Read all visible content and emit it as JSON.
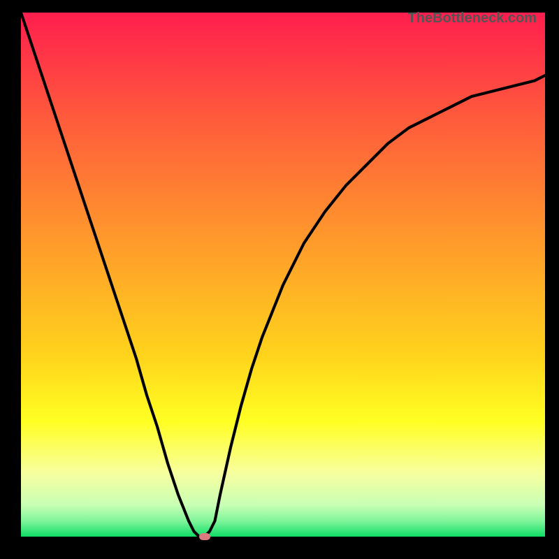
{
  "watermark": "TheBottleneck.com",
  "chart_data": {
    "type": "line",
    "title": "",
    "xlabel": "",
    "ylabel": "",
    "xlim": [
      0,
      100
    ],
    "ylim": [
      0,
      100
    ],
    "grid": false,
    "series": [
      {
        "name": "bottleneck-curve",
        "x": [
          0,
          2,
          4,
          6,
          8,
          10,
          12,
          14,
          16,
          18,
          20,
          22,
          24,
          26,
          28,
          30,
          32,
          33,
          34,
          35,
          36,
          37,
          38,
          40,
          42,
          44,
          46,
          48,
          50,
          54,
          58,
          62,
          66,
          70,
          74,
          78,
          82,
          86,
          90,
          94,
          98,
          100
        ],
        "y": [
          100,
          94,
          88,
          82,
          76,
          70,
          64,
          58,
          52,
          46,
          40,
          34,
          27,
          21,
          14,
          8,
          3,
          1,
          0,
          0,
          1,
          3,
          8,
          17,
          25,
          32,
          38,
          43,
          48,
          56,
          62,
          67,
          71,
          75,
          78,
          80,
          82,
          84,
          85,
          86,
          87,
          88
        ]
      }
    ],
    "marker": {
      "x": 35,
      "y": 0,
      "color": "#dd7a7f"
    },
    "gradient_stops": [
      {
        "offset": 0,
        "color": "#ff1e4e"
      },
      {
        "offset": 20,
        "color": "#ff5a3c"
      },
      {
        "offset": 45,
        "color": "#ff9e2a"
      },
      {
        "offset": 65,
        "color": "#ffd21c"
      },
      {
        "offset": 78,
        "color": "#ffff22"
      },
      {
        "offset": 88,
        "color": "#f7ffa0"
      },
      {
        "offset": 94,
        "color": "#c8ffb4"
      },
      {
        "offset": 97,
        "color": "#80f59a"
      },
      {
        "offset": 100,
        "color": "#0edd66"
      }
    ]
  }
}
